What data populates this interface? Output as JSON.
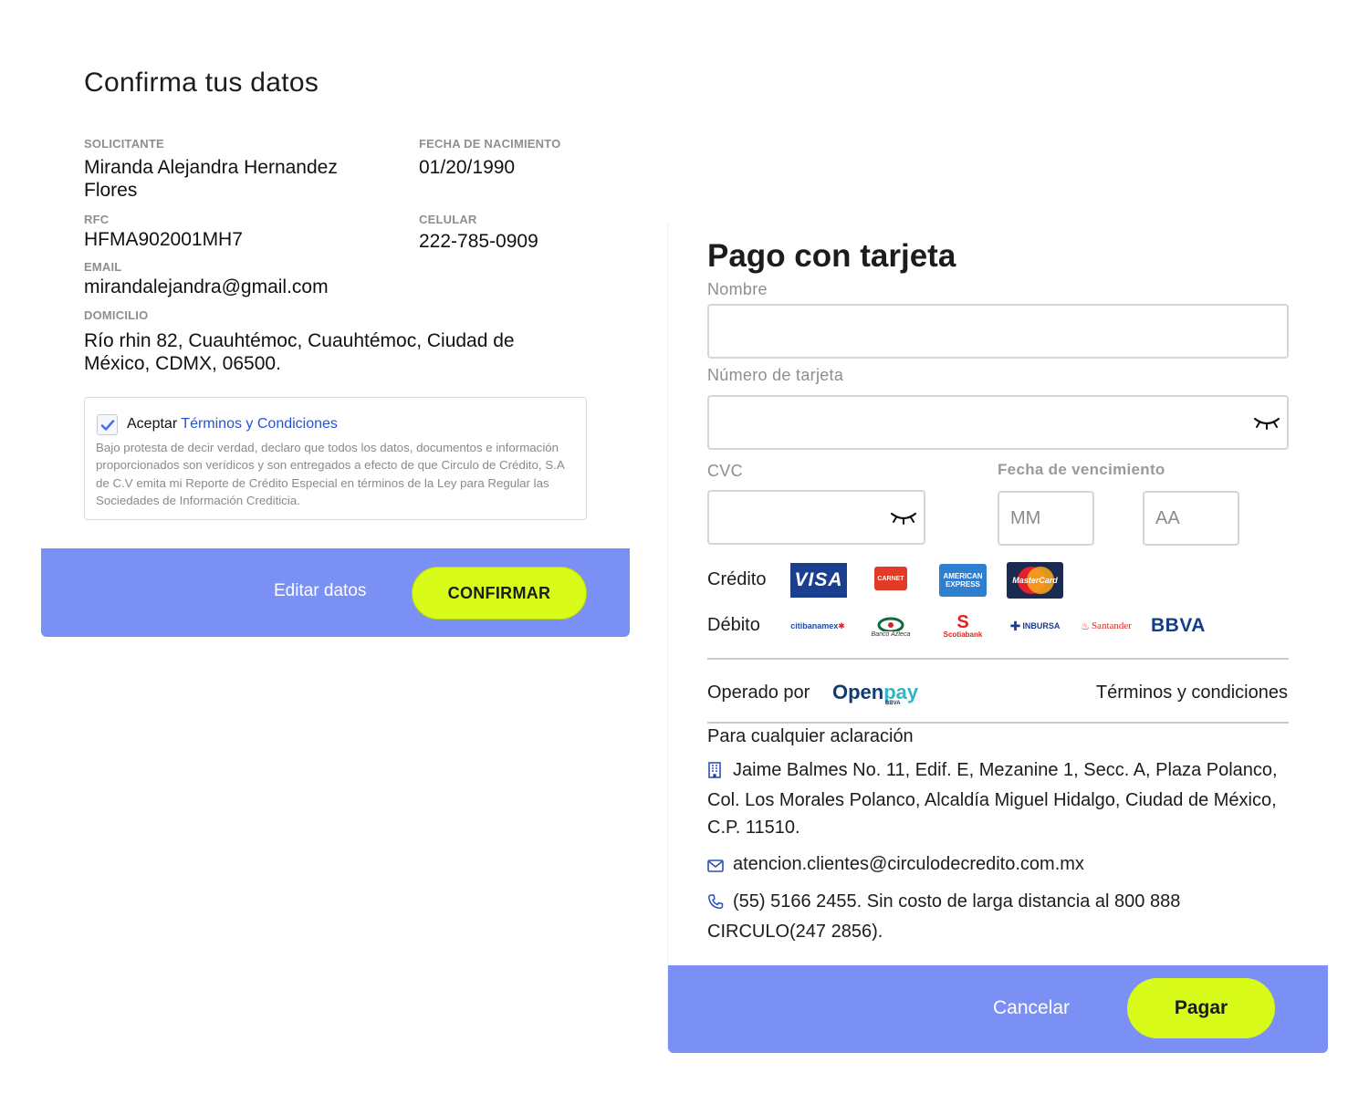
{
  "confirm": {
    "title": "Confirma tus datos",
    "applicant_label": "SOLICITANTE",
    "applicant_name": "Miranda Alejandra Hernandez Flores",
    "dob_label": "FECHA DE NACIMIENTO",
    "dob": "01/20/1990",
    "rfc_label": "RFC",
    "rfc": "HFMA902001MH7",
    "phone_label": "CELULAR",
    "phone": "222-785-0909",
    "email_label": "EMAIL",
    "email": "mirandalejandra@gmail.com",
    "address_label": "DOMICILIO",
    "address": "Río rhin 82, Cuauhtémoc, Cuauhtémoc, Ciudad de México, CDMX, 06500.",
    "terms_accept": "Aceptar",
    "terms_link": "Términos y Condiciones",
    "terms_checked": true,
    "terms_text": "Bajo protesta de decir verdad, declaro que todos los datos, documentos e información proporcionados son verídicos y son entregados a efecto de que Circulo de Crédito, S.A de C.V emita mi Reporte de Crédito Especial en términos de la Ley para Regular las Sociedades de Información Crediticia.",
    "edit_label": "Editar datos",
    "confirm_label": "CONFIRMAR"
  },
  "payment": {
    "title": "Pago con tarjeta",
    "name_label": "Nombre",
    "name_value": "",
    "card_label": "Número de tarjeta",
    "card_value": "",
    "cvc_label": "CVC",
    "cvc_value": "",
    "expiry_label": "Fecha de vencimiento",
    "month_placeholder": "MM",
    "year_placeholder": "AA",
    "credit_label": "Crédito",
    "credit_brands": [
      "visa-logo",
      "carnet-logo",
      "american-express-logo",
      "mastercard-logo"
    ],
    "debit_label": "Débito",
    "debit_brands": [
      "citibanamex-logo",
      "banco-azteca-logo",
      "scotiabank-logo",
      "inbursa-logo",
      "santander-logo",
      "bbva-logo"
    ],
    "logo_text": {
      "visa": "VISA",
      "carnet": "CARNET",
      "amex_1": "AMERICAN",
      "amex_2": "EXPRESS",
      "mastercard": "MasterCard",
      "citibanamex": "citibanamex",
      "azteca": "Banco Azteca",
      "scotiabank": "Scotiabank",
      "inbursa": "INBURSA",
      "santander": "Santander",
      "bbva": "BBVA"
    },
    "operated_by": "Operado por",
    "openpay_1": "Open",
    "openpay_2": "pay",
    "openpay_sub": "BBVA",
    "terms_link": "Términos y condiciones",
    "clarification_title": "Para cualquier aclaración",
    "address": "Jaime Balmes No. 11, Edif. E, Mezanine 1, Secc. A, Plaza Polanco, Col. Los Morales Polanco, Alcaldía Miguel Hidalgo, Ciudad de México, C.P. 11510.",
    "email": "atencion.clientes@circulodecredito.com.mx",
    "phone": "(55) 5166 2455. Sin costo de larga distancia al 800 888 CIRCULO(247 2856).",
    "cancel_label": "Cancelar",
    "pay_label": "Pagar"
  },
  "colors": {
    "footer": "#7a90f4",
    "accent_button": "#d8fb1a",
    "link": "#2452d6"
  }
}
